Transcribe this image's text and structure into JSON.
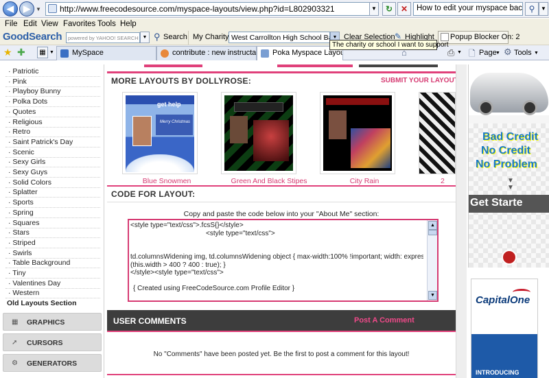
{
  "browser": {
    "url": "http://www.freecodesource.com/myspace-layouts/view.php?id=L802903321",
    "search_text": "How to edit your myspace background",
    "menu": [
      "File",
      "Edit",
      "View",
      "Favorites",
      "Tools",
      "Help"
    ],
    "toolbar": {
      "logo": "GoodSearch",
      "powered": "powered by YAHOO! SEARCH",
      "search_label": "Search",
      "charity_label": "My Charity:",
      "charity_value": "West Carrollton High School Band Boo",
      "clear_label": "Clear Selection",
      "highlight_label": "Highlight",
      "popup_label": "Popup Blocker On: 2",
      "tooltip": "The charity or school I want to support"
    },
    "tabs": [
      {
        "label": "MySpace"
      },
      {
        "label": "contribute : new instructable"
      },
      {
        "label": "Poka Myspace Layouts, ..."
      }
    ],
    "cmd": {
      "page": "Page",
      "tools": "Tools"
    }
  },
  "sidebar": {
    "items": [
      "Patriotic",
      "Pink",
      "Playboy Bunny",
      "Polka Dots",
      "Quotes",
      "Religious",
      "Retro",
      "Saint Patrick's Day",
      "Scenic",
      "Sexy Girls",
      "Sexy Guys",
      "Solid Colors",
      "Splatter",
      "Sports",
      "Spring",
      "Squares",
      "Stars",
      "Striped",
      "Swirls",
      "Table Background",
      "Tiny",
      "Valentines Day",
      "Western"
    ],
    "old_layouts": "Old Layouts Section",
    "buttons": [
      "GRAPHICS",
      "CURSORS",
      "GENERATORS"
    ]
  },
  "main": {
    "more_title": "MORE LAYOUTS BY DOLLYROSE:",
    "submit_link": "SUBMIT YOUR LAYOUTS",
    "thumbs": [
      {
        "caption": "Blue Snowmen",
        "thumb_text": "get help",
        "thumb_sub": "Merry Christmas"
      },
      {
        "caption": "Green And Black Stipes"
      },
      {
        "caption": "City Rain"
      }
    ],
    "thumb_fourth_caption": "2",
    "code_title": "CODE FOR LAYOUT:",
    "code_instructions": "Copy and paste the code below into your \"About Me\" section:",
    "code_lines": [
      "<style type=\"text/css\">.fcsS{}</style>",
      "<style type=\"text/css\">",
      "td.columnsWidening img, td.columnsWidening object { max-width:100% !important; width: expression",
      "(this.width > 400 ? 400 : true); }",
      "</style><style type=\"text/css\">",
      "{ Created using FreeCodeSource.com Profile Editor }"
    ],
    "user_comments_title": "USER COMMENTS",
    "post_comment": "Post A Comment",
    "no_comments": "No \"Comments\" have been posted yet. Be the first to post a comment for this layout!"
  },
  "ads": {
    "car_lines": [
      "Bad Credit",
      "No Credit",
      "No Problem"
    ],
    "get_started": "Get Starte",
    "bank": "CapitalOne",
    "bank_foot": "INTRODUCING"
  }
}
